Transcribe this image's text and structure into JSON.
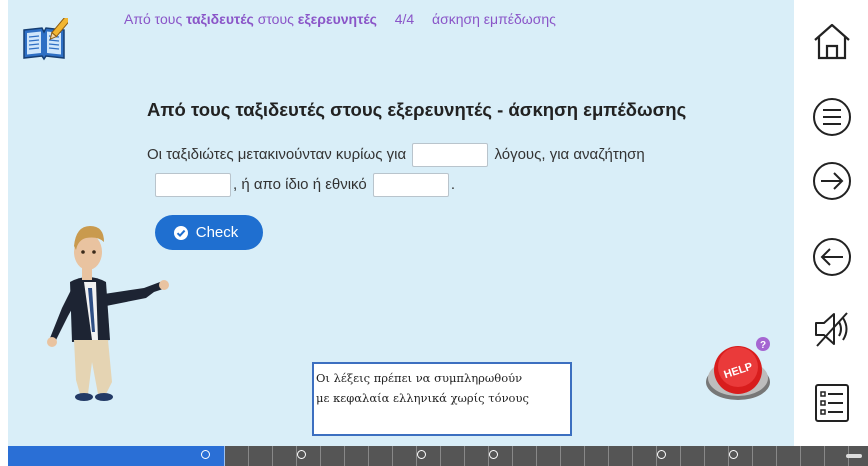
{
  "header": {
    "part1": "Από τους",
    "bold1": "ταξιδευτές",
    "part2": "στους",
    "bold2": "εξερευνητές",
    "counter": "4/4",
    "subtitle": "άσκηση εμπέδωσης"
  },
  "exercise": {
    "title": "Από τους ταξιδευτές στους εξερευνητές - άσκηση εμπέδωσης",
    "text1": "Οι ταξιδιώτες μετακινούνταν κυρίως για",
    "text2": "λόγους, για αναζήτηση",
    "text3": ", ή απο ίδιο ή εθνικό",
    "text4": ".",
    "check_label": "Check"
  },
  "note": {
    "line1": "Οι λέξεις πρέπει να συμπληρωθούν",
    "line2": "με κεφαλαία ελληνικά χωρίς τόνους"
  },
  "help": {
    "label": "HELP",
    "badge": "?"
  },
  "sidebar": {
    "icons": [
      "home-icon",
      "menu-icon",
      "next-arrow-icon",
      "back-arrow-icon",
      "mute-icon",
      "list-icon"
    ]
  },
  "colors": {
    "accent_purple": "#8a55c8",
    "check_blue": "#1f6fd0",
    "stage_bg": "#d9eef8",
    "help_red": "#d81d1d"
  }
}
